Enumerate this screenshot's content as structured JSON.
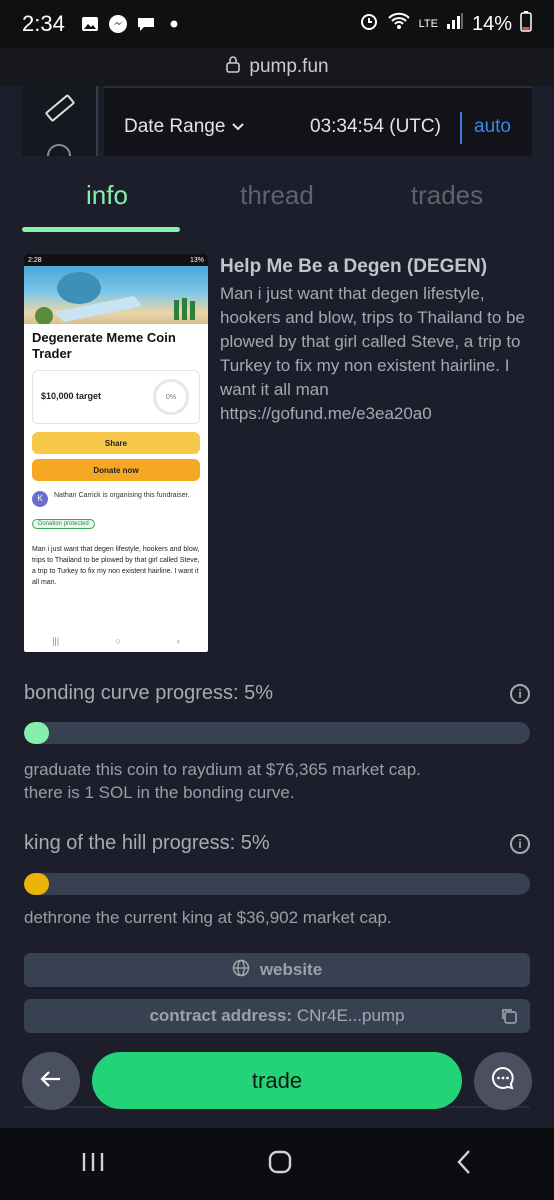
{
  "statusbar": {
    "time": "2:34",
    "battery": "14%",
    "network": "LTE"
  },
  "url": "pump.fun",
  "chart_header": {
    "date_range": "Date Range",
    "clock": "03:34:54 (UTC)",
    "auto": "auto"
  },
  "tabs": [
    {
      "label": "info"
    },
    {
      "label": "thread"
    },
    {
      "label": "trades"
    }
  ],
  "thumbnail": {
    "status_time": "2:28",
    "status_batt": "13%",
    "title": "Degenerate Meme Coin Trader",
    "target": "$10,000 target",
    "percent": "0%",
    "share": "Share",
    "donate": "Donate now",
    "organiser_initial": "K",
    "organiser": "Nathan Carrick is organising this fundraiser.",
    "protected": "Donation protected",
    "desc": "Man i just want that degen lifestyle, hookers and blow, trips to Thailand to be plowed by that girl called Steve, a trip to Turkey to fix my non existent hairline. I want it all man."
  },
  "coin": {
    "name": "Help Me Be a Degen (DEGEN)",
    "description": "Man i just want that degen lifestyle, hookers and blow, trips to Thailand to be plowed by that girl called Steve, a trip to Turkey to fix my non existent hairline. I want it all man https://gofund.me/e3ea20a0"
  },
  "bonding": {
    "label": "bonding curve progress: 5%",
    "progress": 0.05,
    "line1": "graduate this coin to raydium at $76,365 market cap.",
    "line2": "there is 1 SOL in the bonding curve.",
    "color": "#86efac"
  },
  "koth": {
    "label": "king of the hill progress: 5%",
    "progress": 0.05,
    "line1": "dethrone the current king at $36,902 market cap.",
    "color": "#eab308"
  },
  "website_label": "website",
  "contract": {
    "label": "contract address:",
    "value": "CNr4E...pump"
  },
  "trade_label": "trade",
  "colors": {
    "accent": "#22d477",
    "background": "#1c1f2b",
    "track": "#374151"
  }
}
